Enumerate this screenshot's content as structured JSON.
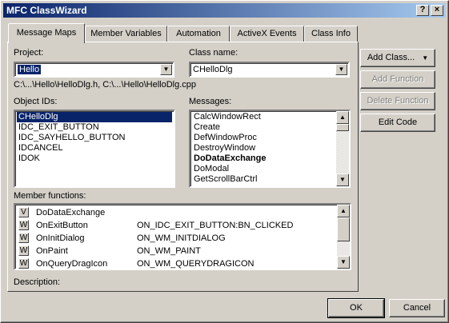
{
  "window": {
    "title": "MFC ClassWizard"
  },
  "titlebar_buttons": {
    "help": "?",
    "close": "×"
  },
  "tabs": [
    {
      "label": "Message Maps",
      "active": true
    },
    {
      "label": "Member Variables",
      "active": false
    },
    {
      "label": "Automation",
      "active": false
    },
    {
      "label": "ActiveX Events",
      "active": false
    },
    {
      "label": "Class Info",
      "active": false
    }
  ],
  "project": {
    "label": "Project:",
    "value": "Hello"
  },
  "class_name": {
    "label": "Class name:",
    "value": "CHelloDlg"
  },
  "file_path": "C:\\...\\Hello\\HelloDlg.h, C:\\...\\Hello\\HelloDlg.cpp",
  "object_ids": {
    "label": "Object IDs:",
    "items": [
      "CHelloDlg",
      "IDC_EXIT_BUTTON",
      "IDC_SAYHELLO_BUTTON",
      "IDCANCEL",
      "IDOK"
    ],
    "selected": 0
  },
  "messages": {
    "label": "Messages:",
    "items": [
      "CalcWindowRect",
      "Create",
      "DefWindowProc",
      "DestroyWindow",
      "DoDataExchange",
      "DoModal",
      "GetScrollBarCtrl"
    ],
    "bold_index": 4
  },
  "member_functions": {
    "label": "Member functions:",
    "rows": [
      {
        "icon": "V",
        "name": "DoDataExchange",
        "handler": ""
      },
      {
        "icon": "W",
        "name": "OnExitButton",
        "handler": "ON_IDC_EXIT_BUTTON:BN_CLICKED"
      },
      {
        "icon": "W",
        "name": "OnInitDialog",
        "handler": "ON_WM_INITDIALOG"
      },
      {
        "icon": "W",
        "name": "OnPaint",
        "handler": "ON_WM_PAINT"
      },
      {
        "icon": "W",
        "name": "OnQueryDragIcon",
        "handler": "ON_WM_QUERYDRAGICON"
      }
    ]
  },
  "description": {
    "label": "Description:"
  },
  "buttons": {
    "add_class": "Add Class...",
    "add_class_arrow": "▼",
    "add_function": "Add Function",
    "delete_function": "Delete Function",
    "edit_code": "Edit Code",
    "ok": "OK",
    "cancel": "Cancel"
  },
  "glyphs": {
    "drop_down": "▼",
    "scroll_up": "▲",
    "scroll_down": "▼"
  }
}
